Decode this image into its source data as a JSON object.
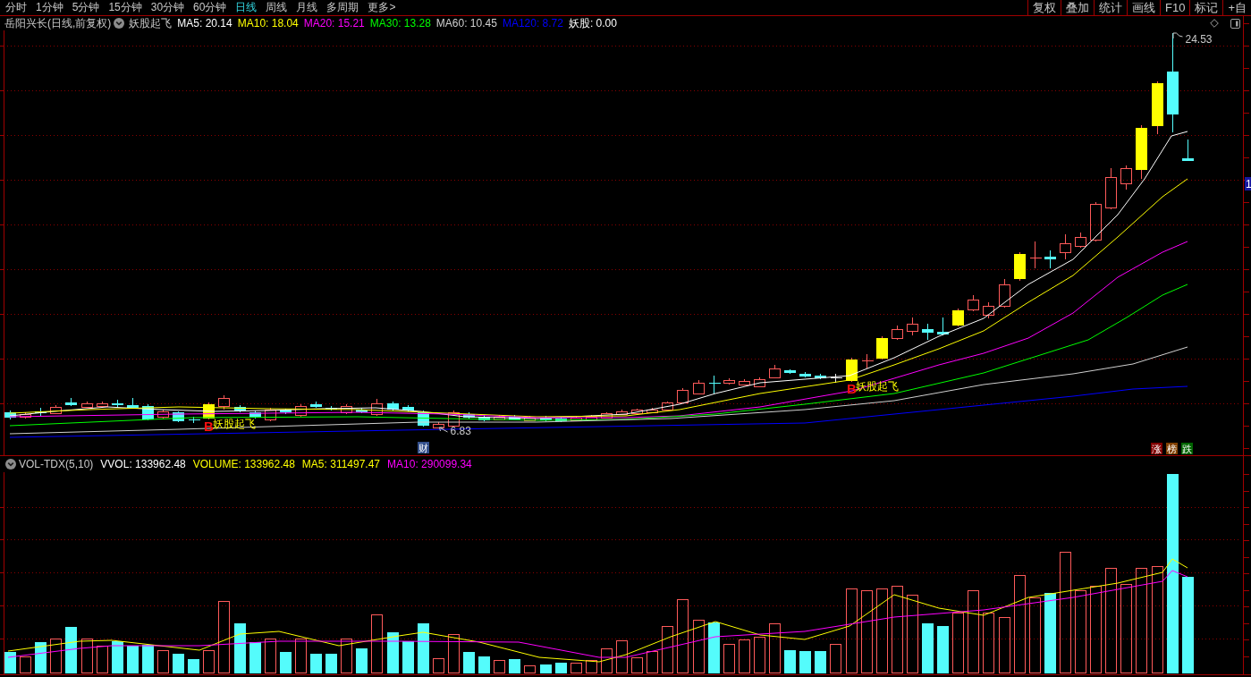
{
  "period_tabs": [
    {
      "label": "分时",
      "selected": false
    },
    {
      "label": "1分钟",
      "selected": false
    },
    {
      "label": "5分钟",
      "selected": false
    },
    {
      "label": "15分钟",
      "selected": false
    },
    {
      "label": "30分钟",
      "selected": false
    },
    {
      "label": "60分钟",
      "selected": false
    },
    {
      "label": "日线",
      "selected": true
    },
    {
      "label": "周线",
      "selected": false
    },
    {
      "label": "月线",
      "selected": false
    },
    {
      "label": "多周期",
      "selected": false
    },
    {
      "label": "更多>",
      "selected": false
    }
  ],
  "toolbar_buttons": [
    "复权",
    "叠加",
    "统计",
    "画线",
    "F10",
    "标记",
    "+自"
  ],
  "price_panel": {
    "title": "岳阳兴长(日线,前复权)",
    "indicator": "妖股起飞",
    "values": [
      {
        "label": "MA5: 20.14",
        "color": "#ffffff"
      },
      {
        "label": "MA10: 18.04",
        "color": "#ffff00"
      },
      {
        "label": "MA20: 15.21",
        "color": "#ff00ff"
      },
      {
        "label": "MA30: 13.28",
        "color": "#00ff00"
      },
      {
        "label": "MA60: 10.45",
        "color": "#d0d0d0"
      },
      {
        "label": "MA120: 8.72",
        "color": "#0000ff"
      },
      {
        "label": "妖股: 0.00",
        "color": "#ffffff"
      }
    ],
    "high_label": "24.53",
    "low_label": "6.83",
    "signals": [
      {
        "mark": "B",
        "label": "妖股起飞"
      },
      {
        "mark": "B",
        "label": "妖股起飞"
      }
    ],
    "finance_marker": "财",
    "rank_buttons": [
      {
        "label": "涨",
        "color": "#800000"
      },
      {
        "label": "榜",
        "color": "#804000"
      },
      {
        "label": "跌",
        "color": "#006400"
      }
    ],
    "axis_label": "1"
  },
  "volume_panel": {
    "title": "VOL-TDX(5,10)",
    "values": [
      {
        "label": "VVOL: 133962.48",
        "color": "#ffffff"
      },
      {
        "label": "VOLUME: 133962.48",
        "color": "#ffff00"
      },
      {
        "label": "MA5: 311497.47",
        "color": "#ffff00"
      },
      {
        "label": "MA10: 290099.34",
        "color": "#ff00ff"
      }
    ]
  }
}
